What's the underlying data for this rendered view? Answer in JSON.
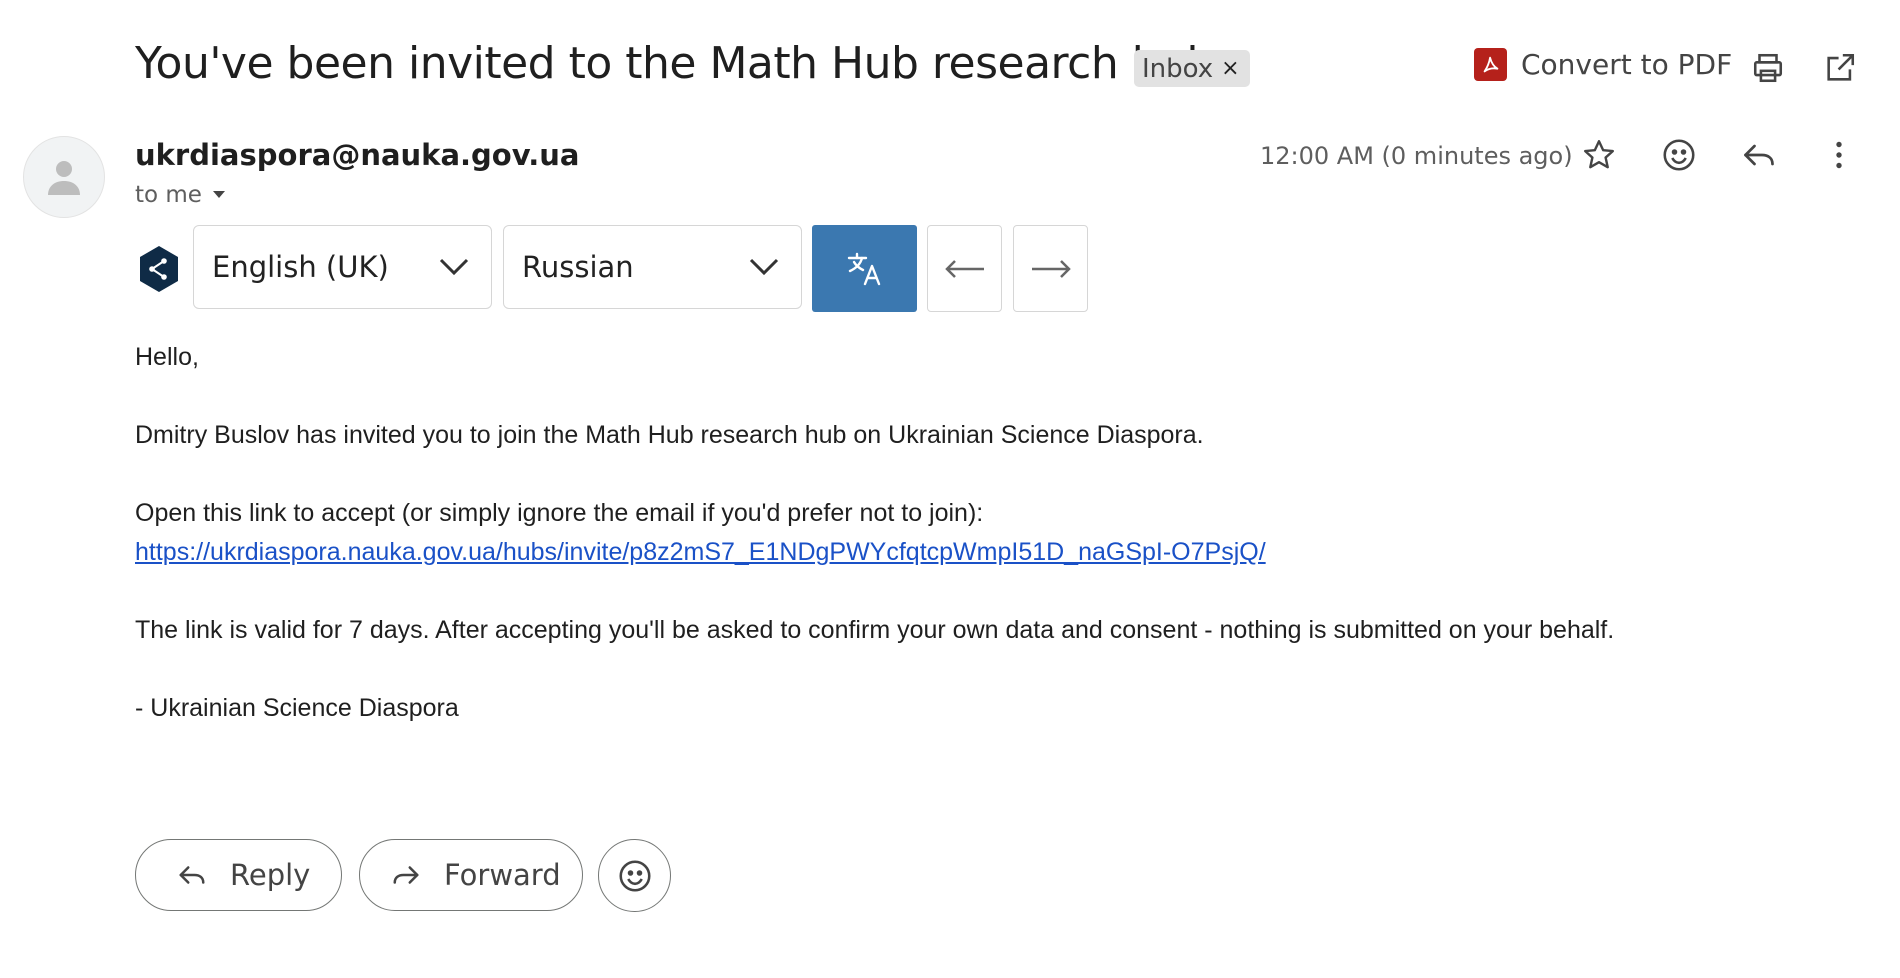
{
  "subject": "You've been invited to the Math Hub research hub",
  "label_chip": {
    "text": "Inbox",
    "remove": "×"
  },
  "toolbar": {
    "convert_pdf": "Convert to PDF"
  },
  "sender": {
    "email": "ukrdiaspora@nauka.gov.ua",
    "to": "to me",
    "time": "12:00 AM (0 minutes ago)"
  },
  "translate": {
    "source_lang": "English (UK)",
    "target_lang": "Russian"
  },
  "body": {
    "greeting": "Hello,",
    "p1": "Dmitry Buslov has invited you to join the Math Hub research hub on Ukrainian Science Diaspora.",
    "p2": "Open this link to accept (or simply ignore the email if you'd prefer not to join):",
    "link": "https://ukrdiaspora.nauka.gov.ua/hubs/invite/p8z2mS7_E1NDgPWYcfqtcpWmpI51D_naGSpI-O7PsjQ/",
    "p3": "The link is valid for 7 days. After accepting you'll be asked to confirm your own data and consent - nothing is submitted on your behalf.",
    "signature": "- Ukrainian Science Diaspora"
  },
  "actions": {
    "reply": "Reply",
    "forward": "Forward"
  },
  "colors": {
    "accent_translate": "#3b78b0",
    "link": "#1a51c7",
    "pdf_red": "#b5211b"
  }
}
